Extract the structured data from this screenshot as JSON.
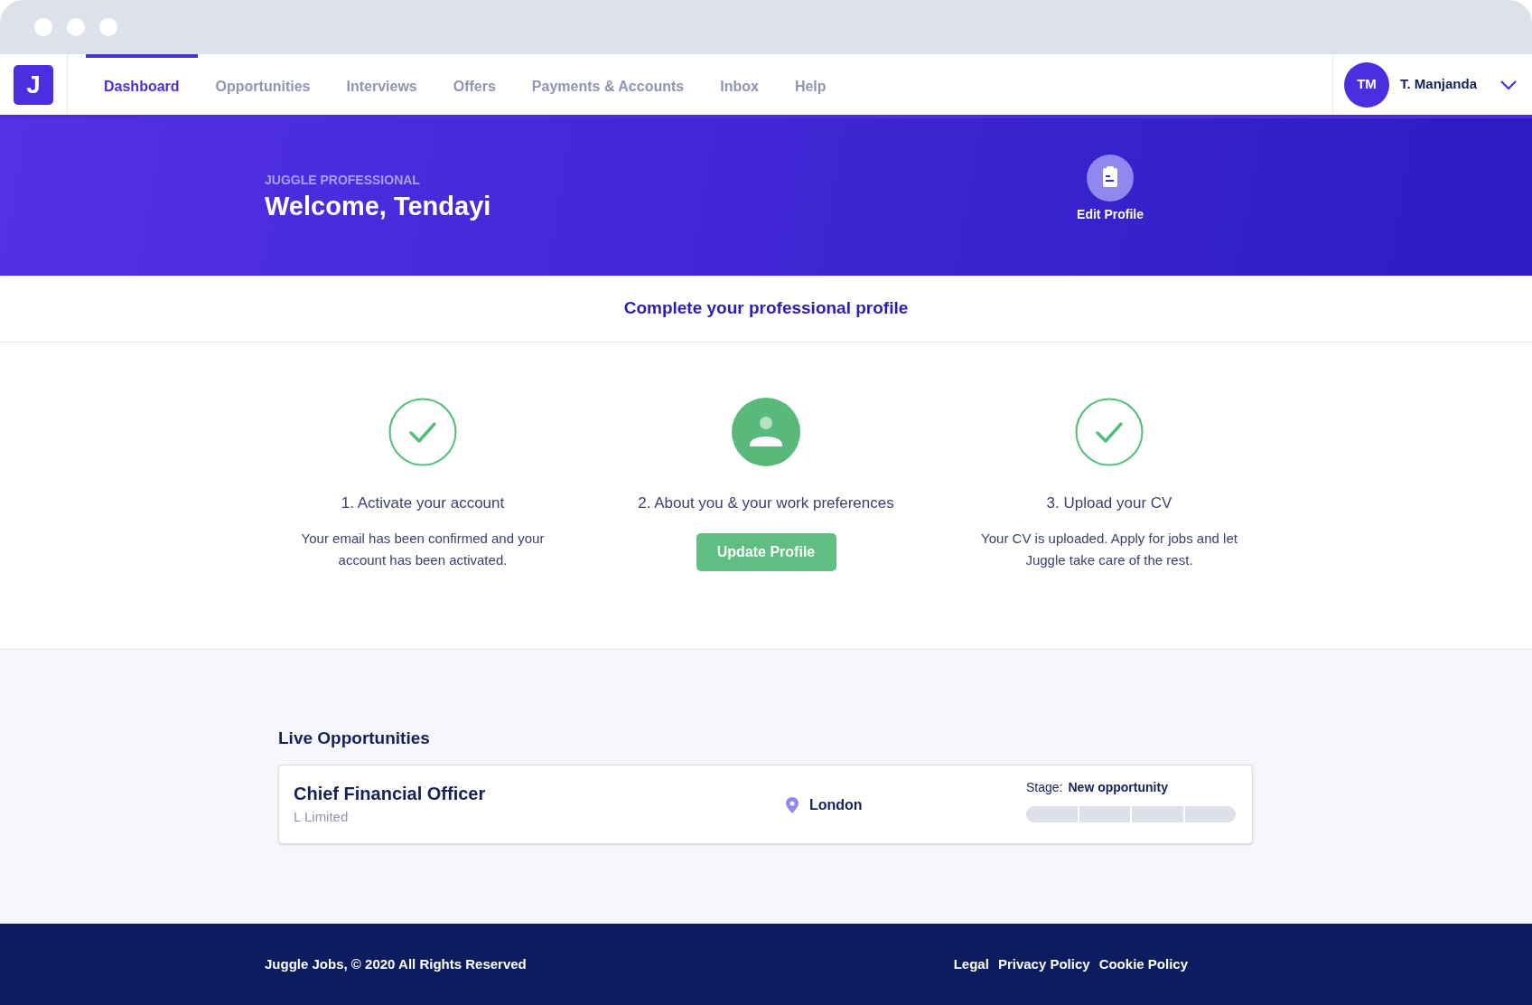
{
  "nav": {
    "logo": "J",
    "tabs": [
      {
        "label": "Dashboard",
        "selected": true
      },
      {
        "label": "Opportunities",
        "selected": false
      },
      {
        "label": "Interviews",
        "selected": false
      },
      {
        "label": "Offers",
        "selected": false
      },
      {
        "label": "Payments & Accounts",
        "selected": false
      },
      {
        "label": "Inbox",
        "selected": false
      },
      {
        "label": "Help",
        "selected": false
      }
    ],
    "user": {
      "initials": "TM",
      "name": "T. Manjanda"
    }
  },
  "banner": {
    "eyebrow": "JUGGLE PROFESSIONAL",
    "title": "Welcome, Tendayi",
    "action": "Edit Profile"
  },
  "profile": {
    "heading": "Complete your professional profile",
    "steps": [
      {
        "kind": "done",
        "title": "1. Activate your account",
        "description": "Your email has been confirmed and your account has been activated."
      },
      {
        "kind": "pending",
        "title": "2. About you & your work preferences",
        "button": "Update Profile"
      },
      {
        "kind": "done",
        "title": "3. Upload your CV",
        "description": "Your CV is uploaded. Apply for jobs and let Juggle take care of the rest."
      }
    ]
  },
  "opportunities": {
    "heading": "Live Opportunities",
    "items": [
      {
        "title": "Chief Financial Officer",
        "company": "L Limited",
        "location": "London",
        "stage_label": "Stage:",
        "stage": "New opportunity",
        "segments": [
          {
            "filled": false
          },
          {
            "filled": false
          },
          {
            "filled": false
          },
          {
            "filled": false
          }
        ]
      }
    ]
  },
  "footer": {
    "copyright": "Juggle Jobs, © 2020 All Rights Reserved",
    "links": [
      "Legal",
      "Privacy Policy",
      "Cookie Policy"
    ]
  }
}
